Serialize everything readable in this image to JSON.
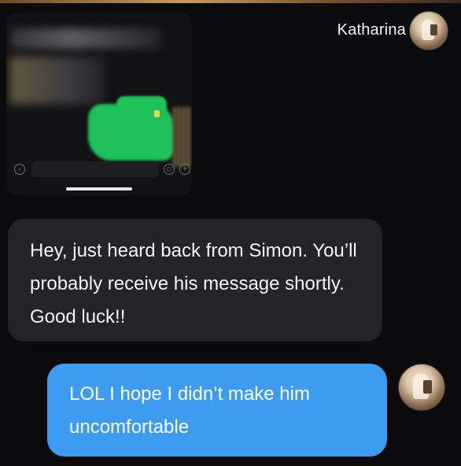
{
  "header": {
    "contact_name": "Katharina"
  },
  "shared_screenshot": {
    "description_icons": [
      "plus-circle-icon",
      "emoji-icon",
      "back-circle-icon"
    ]
  },
  "messages": [
    {
      "direction": "incoming",
      "text": "Hey, just heard back from Simon. You’ll probably receive his message shortly. Good luck!!"
    },
    {
      "direction": "outgoing",
      "text": "LOL I hope I didn’t make him uncomfortable"
    }
  ],
  "colors": {
    "background": "#0b0b0d",
    "incoming_bubble": "#242426",
    "outgoing_bubble": "#3d9bf0"
  }
}
